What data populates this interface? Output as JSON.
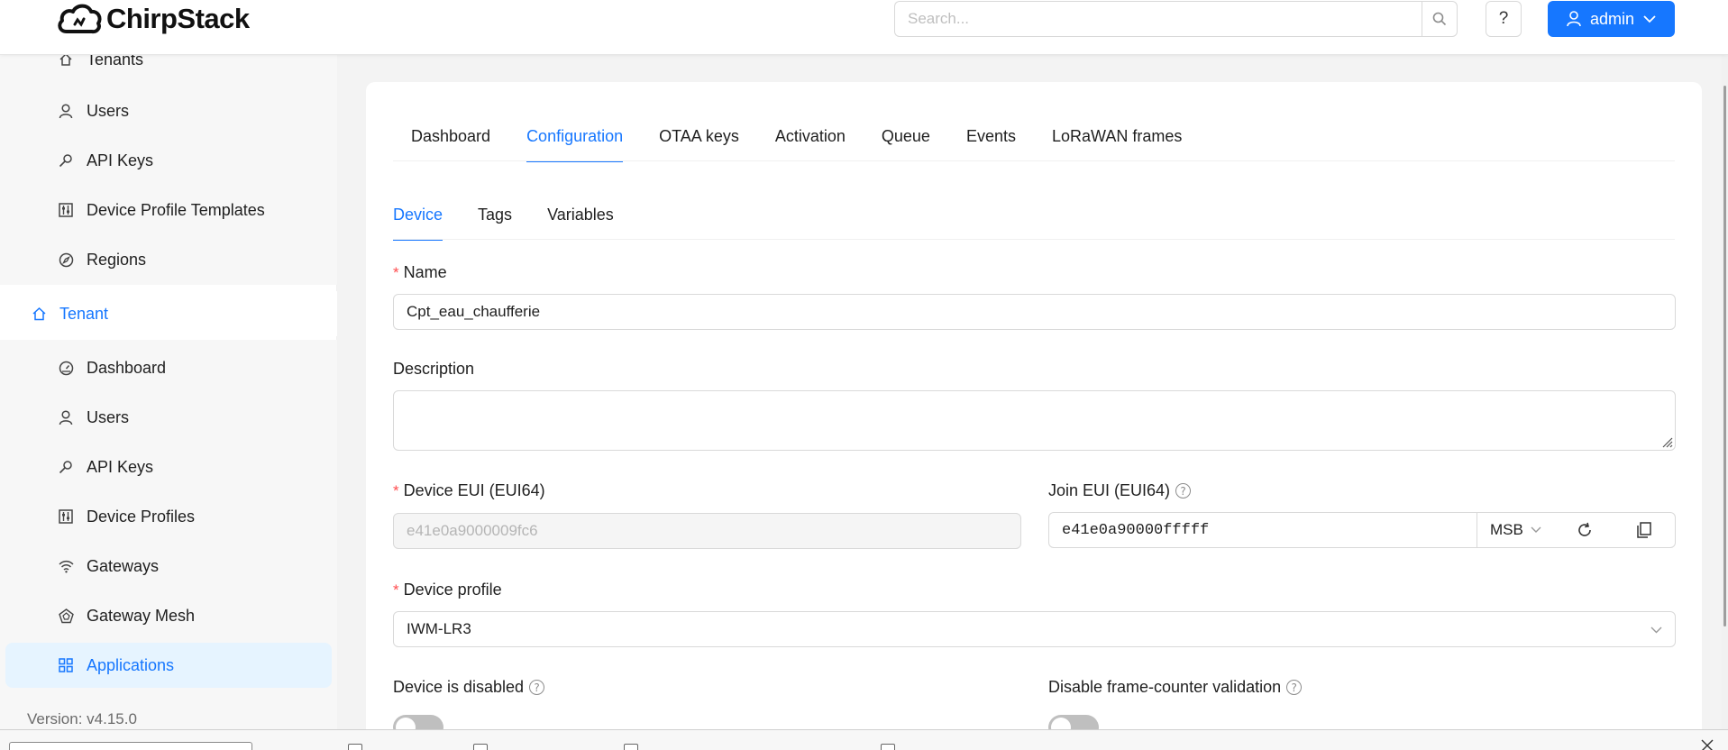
{
  "header": {
    "brand": "ChirpStack",
    "search_placeholder": "Search...",
    "help_label": "?",
    "user_label": "admin"
  },
  "sidebar": {
    "items": [
      {
        "label": "Tenants",
        "icon": "home-icon"
      },
      {
        "label": "Users",
        "icon": "user-icon"
      },
      {
        "label": "API Keys",
        "icon": "key-icon"
      },
      {
        "label": "Device Profile Templates",
        "icon": "sliders-icon"
      },
      {
        "label": "Regions",
        "icon": "compass-icon"
      },
      {
        "label": "Tenant",
        "icon": "home-icon"
      },
      {
        "label": "Dashboard",
        "icon": "dashboard-icon"
      },
      {
        "label": "Users",
        "icon": "user-icon"
      },
      {
        "label": "API Keys",
        "icon": "key-icon"
      },
      {
        "label": "Device Profiles",
        "icon": "sliders-icon"
      },
      {
        "label": "Gateways",
        "icon": "wifi-icon"
      },
      {
        "label": "Gateway Mesh",
        "icon": "mesh-icon"
      },
      {
        "label": "Applications",
        "icon": "apps-icon"
      }
    ],
    "version": "Version: v4.15.0"
  },
  "main": {
    "tabs": [
      "Dashboard",
      "Configuration",
      "OTAA keys",
      "Activation",
      "Queue",
      "Events",
      "LoRaWAN frames"
    ],
    "active_tab": "Configuration",
    "subtabs": [
      "Device",
      "Tags",
      "Variables"
    ],
    "active_subtab": "Device",
    "form": {
      "name_label": "Name",
      "name_value": "Cpt_eau_chaufferie",
      "description_label": "Description",
      "description_value": "",
      "dev_eui_label": "Device EUI (EUI64)",
      "dev_eui_value": "e41e0a9000009fc6",
      "join_eui_label": "Join EUI (EUI64)",
      "join_eui_value": "e41e0a90000fffff",
      "byte_order": "MSB",
      "device_profile_label": "Device profile",
      "device_profile_value": "IWM-LR3",
      "disabled_label": "Device is disabled",
      "fcnt_label": "Disable frame-counter validation"
    }
  },
  "colors": {
    "accent": "#1677ff",
    "required": "#ff4d4f",
    "selected_bg": "#e6f4ff"
  }
}
